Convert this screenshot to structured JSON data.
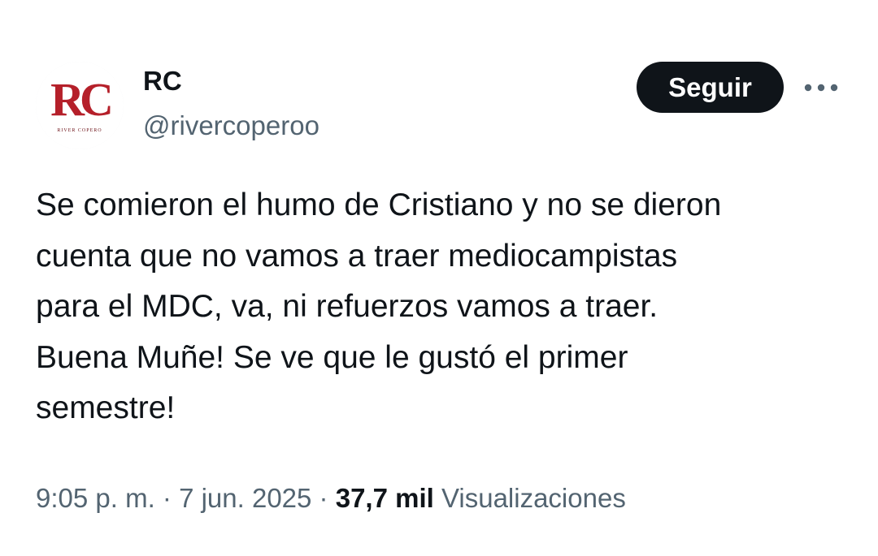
{
  "author": {
    "name": "RC",
    "handle": "@rivercoperoo",
    "avatar_text": "RC",
    "avatar_caption": "RIVER COPERO"
  },
  "actions": {
    "follow_label": "Seguir",
    "more_icon": "more-horizontal-icon"
  },
  "tweet": {
    "text": "Se comieron el humo de Cristiano y no se dieron\ncuenta que no vamos a traer mediocampistas\npara el MDC, va, ni refuerzos vamos a traer.\nBuena Muñe! Se ve que le gustó el primer\nsemestre!"
  },
  "meta": {
    "time": "9:05 p. m.",
    "separator": " · ",
    "date": "7 jun. 2025",
    "views_count": "37,7 mil",
    "views_label": "Visualizaciones"
  },
  "colors": {
    "text_primary": "#0f1419",
    "text_secondary": "#536471",
    "button_bg": "#0f1419",
    "brand_red": "#b5202a"
  }
}
